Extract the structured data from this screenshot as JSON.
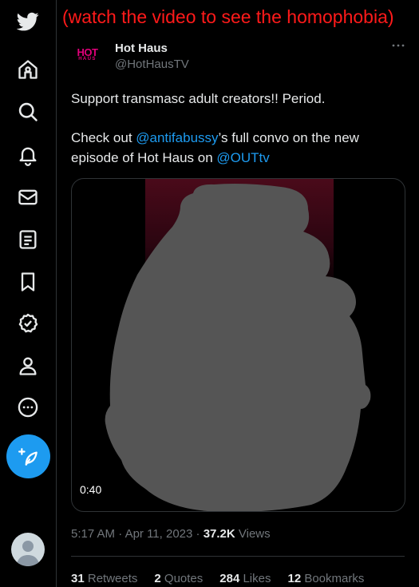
{
  "overlay_caption": "(watch the video to see the homophobia)",
  "nav": [
    {
      "icon": "twitter-bird-icon"
    },
    {
      "icon": "home-icon"
    },
    {
      "icon": "explore-icon"
    },
    {
      "icon": "notifications-icon"
    },
    {
      "icon": "messages-icon"
    },
    {
      "icon": "lists-icon"
    },
    {
      "icon": "bookmarks-icon"
    },
    {
      "icon": "verified-icon"
    },
    {
      "icon": "profile-icon"
    },
    {
      "icon": "more-icon"
    },
    {
      "icon": "compose-tweet-icon"
    }
  ],
  "tweet": {
    "author": {
      "name": "Hot Haus",
      "handle": "@HotHausTV",
      "avatar_logo_top": "HOT",
      "avatar_logo_bottom": "HAUS"
    },
    "text_line1": "Support transmasc adult creators!! Period.",
    "text_line2_pre": "Check out ",
    "text_mention1": "@antifabussy",
    "text_line2_post": "’s full convo on the new",
    "text_line3_pre": "episode of Hot Haus on ",
    "text_mention2": "@OUTtv",
    "media": {
      "duration": "0:40"
    },
    "time": "5:17 AM",
    "date": "Apr 11, 2023",
    "separator": " · ",
    "views_count": "37.2K",
    "views_label": " Views",
    "stats": {
      "retweets_count": "31",
      "retweets_label": " Retweets",
      "quotes_count": "2",
      "quotes_label": " Quotes",
      "likes_count": "284",
      "likes_label": " Likes",
      "bookmarks_count": "12",
      "bookmarks_label": " Bookmarks"
    }
  },
  "colors": {
    "accent": "#1d9bf0",
    "caption": "#ff1a1a",
    "background": "#000000",
    "muted": "#71767b",
    "brand_logo": "#e2007a"
  }
}
